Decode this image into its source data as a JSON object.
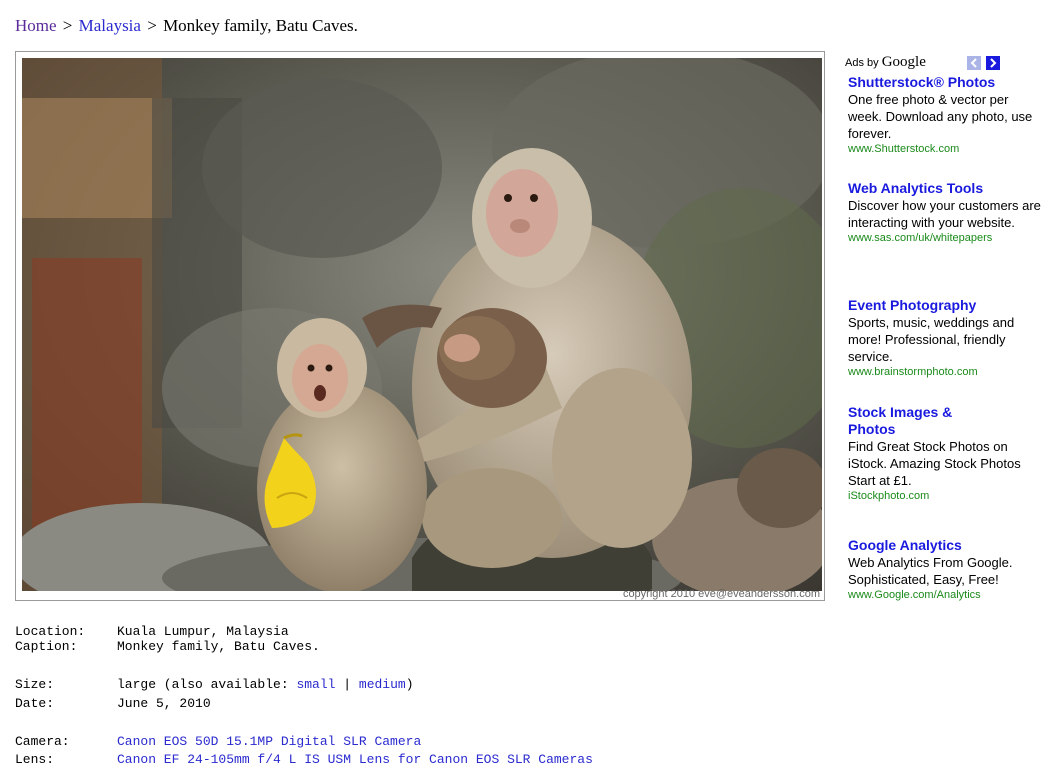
{
  "breadcrumb": {
    "home": "Home",
    "sep1": ">",
    "country": "Malaysia",
    "sep2": ">",
    "current": "Monkey family, Batu Caves."
  },
  "photo": {
    "copyright": "copyright 2010 eve@eveandersson.com"
  },
  "meta": {
    "location_label": "Location:",
    "location": "Kuala Lumpur, Malaysia",
    "caption_label": "Caption:",
    "caption": "Monkey family, Batu Caves.",
    "size_label": "Size:",
    "size_prefix": "large (also available:",
    "size_small": "small",
    "size_sep": "|",
    "size_medium": "medium",
    "size_suffix": ")",
    "date_label": "Date:",
    "date": "June 5, 2010",
    "camera_label": "Camera:",
    "camera": "Canon EOS 50D 15.1MP Digital SLR Camera",
    "lens_label": "Lens:",
    "lens": "Canon EF 24-105mm f/4 L IS USM Lens for Canon EOS SLR Cameras"
  },
  "ads": {
    "ads_by": "Ads by",
    "google": "Google",
    "items": [
      {
        "title": "Shutterstock® Photos",
        "body": "One free photo & vector per week. Download any photo, use forever.",
        "url": "www.Shutterstock.com"
      },
      {
        "title": "Web Analytics Tools",
        "body": "Discover how your customers are interacting with your website.",
        "url": "www.sas.com/uk/whitepapers"
      },
      {
        "title": "Event Photography",
        "body": "Sports, music, weddings and more! Professional, friendly service.",
        "url": "www.brainstormphoto.com"
      },
      {
        "title": "Stock Images & Photos",
        "body": "Find Great Stock Photos on iStock. Amazing Stock Photos Start at £1.",
        "url": "iStockphoto.com"
      },
      {
        "title": "Google Analytics",
        "body": "Web Analytics From Google. Sophisticated, Easy, Free!",
        "url": "www.Google.com/Analytics"
      }
    ]
  }
}
